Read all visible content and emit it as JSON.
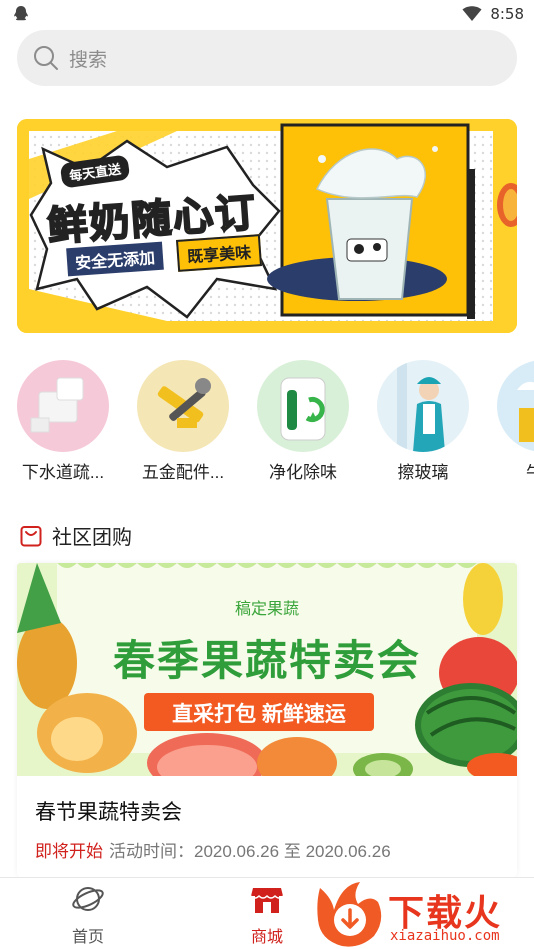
{
  "status_bar": {
    "time": "8:58"
  },
  "search": {
    "placeholder": "搜索"
  },
  "banner": {
    "badge": "每天直送",
    "headline": "鲜奶随心订",
    "tagline_left": "安全无添加",
    "tagline_right": "既享美味"
  },
  "categories": [
    {
      "label": "下水道疏...",
      "icon": "pipe-icon"
    },
    {
      "label": "五金配件...",
      "icon": "tools-icon"
    },
    {
      "label": "净化除味",
      "icon": "air-purifier-icon"
    },
    {
      "label": "擦玻璃",
      "icon": "cleaner-icon"
    },
    {
      "label": "牛奶",
      "icon": "milk-icon"
    }
  ],
  "section": {
    "title": "社区团购",
    "icon": "shopping-bag-icon"
  },
  "promo": {
    "image_kicker": "稿定果蔬",
    "image_headline": "春季果蔬特卖会",
    "image_button": "直采打包 新鲜速运",
    "title": "春节果蔬特卖会",
    "status": "即将开始",
    "time_label": "活动时间：",
    "start_date": "2020.06.26",
    "to": "至",
    "end_date": "2020.06.26"
  },
  "bottom_nav": {
    "items": [
      {
        "label": "首页",
        "icon": "planet-icon",
        "active": false
      },
      {
        "label": "商城",
        "icon": "store-icon",
        "active": true
      }
    ],
    "active_color": "#d0211c",
    "inactive_color": "#555555"
  },
  "watermark": {
    "brand": "下载火",
    "url": "xiazaihuo.com"
  },
  "colors": {
    "accent": "#d0211c",
    "banner_yellow": "#ffd12a",
    "promo_green": "#3aa53a",
    "promo_orange": "#f25a22"
  }
}
